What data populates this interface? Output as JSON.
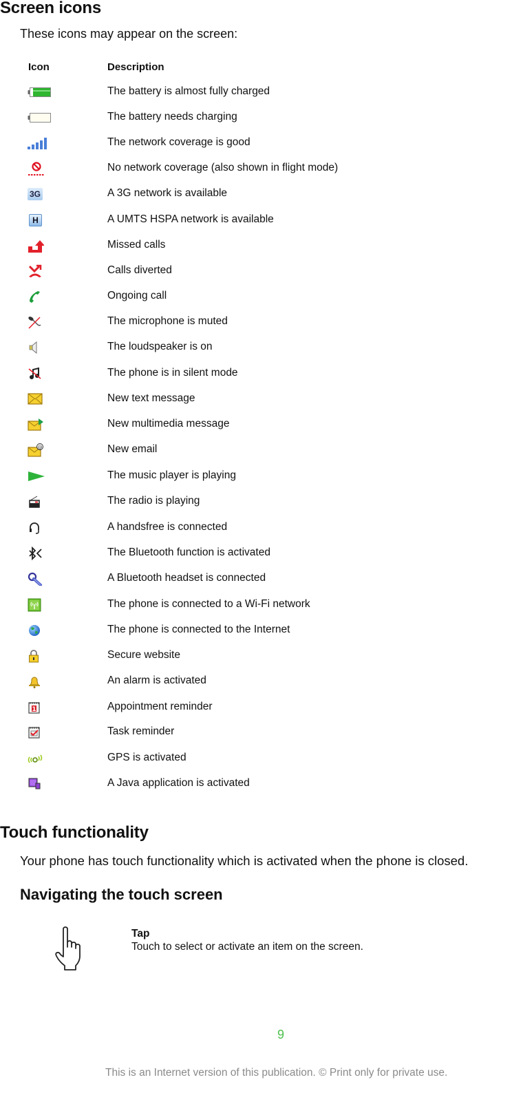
{
  "section1": {
    "title": "Screen icons",
    "intro": "These icons may appear on the screen:",
    "table": {
      "headers": {
        "icon": "Icon",
        "description": "Description"
      },
      "rows": [
        {
          "icon": "battery-full-icon",
          "description": "The battery is almost fully charged"
        },
        {
          "icon": "battery-empty-icon",
          "description": "The battery needs charging"
        },
        {
          "icon": "signal-strength-icon",
          "description": "The network coverage is good"
        },
        {
          "icon": "no-network-icon",
          "description": "No network coverage (also shown in flight mode)"
        },
        {
          "icon": "3g-icon",
          "description": "A 3G network is available",
          "glyph": "3G"
        },
        {
          "icon": "hspa-icon",
          "description": "A UMTS HSPA network is available",
          "glyph": "H"
        },
        {
          "icon": "missed-call-icon",
          "description": "Missed calls"
        },
        {
          "icon": "call-divert-icon",
          "description": "Calls diverted"
        },
        {
          "icon": "ongoing-call-icon",
          "description": "Ongoing call"
        },
        {
          "icon": "mic-muted-icon",
          "description": "The microphone is muted"
        },
        {
          "icon": "loudspeaker-icon",
          "description": "The loudspeaker is on"
        },
        {
          "icon": "silent-mode-icon",
          "description": "The phone is in silent mode"
        },
        {
          "icon": "text-message-icon",
          "description": "New text message"
        },
        {
          "icon": "multimedia-message-icon",
          "description": "New multimedia message"
        },
        {
          "icon": "email-icon",
          "description": "New email"
        },
        {
          "icon": "music-play-icon",
          "description": "The music player is playing"
        },
        {
          "icon": "radio-icon",
          "description": "The radio is playing"
        },
        {
          "icon": "handsfree-icon",
          "description": "A handsfree is connected"
        },
        {
          "icon": "bluetooth-icon",
          "description": "The Bluetooth function is activated"
        },
        {
          "icon": "bluetooth-headset-icon",
          "description": "A Bluetooth headset is connected"
        },
        {
          "icon": "wifi-icon",
          "description": "The phone is connected to a Wi-Fi network"
        },
        {
          "icon": "internet-globe-icon",
          "description": "The phone is connected to the Internet"
        },
        {
          "icon": "padlock-icon",
          "description": "Secure website"
        },
        {
          "icon": "alarm-bell-icon",
          "description": "An alarm is activated"
        },
        {
          "icon": "appointment-icon",
          "description": "Appointment reminder",
          "glyph": "1"
        },
        {
          "icon": "task-icon",
          "description": "Task reminder"
        },
        {
          "icon": "gps-icon",
          "description": "GPS is activated"
        },
        {
          "icon": "java-app-icon",
          "description": "A Java application is activated"
        }
      ]
    }
  },
  "section2": {
    "title": "Touch functionality",
    "intro": "Your phone has touch functionality which is activated when the phone is closed.",
    "subsection": {
      "title": "Navigating the touch screen",
      "items": [
        {
          "icon": "tap-hand-icon",
          "title": "Tap",
          "text": "Touch to select or activate an item on the screen."
        }
      ]
    }
  },
  "footer": {
    "page_number": "9",
    "notice": "This is an Internet version of this publication. © Print only for private use."
  },
  "colors": {
    "page_number": "#4cc04c",
    "footer_text": "#8a8a8a",
    "heading": "#111111"
  }
}
